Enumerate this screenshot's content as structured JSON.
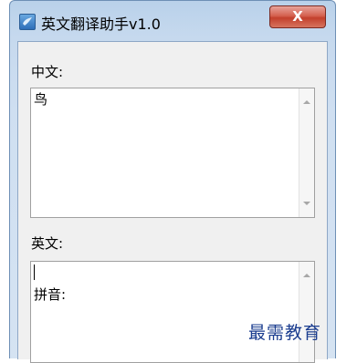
{
  "window": {
    "title": "英文翻译助手v1.0",
    "close_label": "X"
  },
  "chinese": {
    "label": "中文:",
    "value": "鸟"
  },
  "english": {
    "label": "英文:",
    "value": "\n拼音:"
  },
  "watermark": "最需教育"
}
